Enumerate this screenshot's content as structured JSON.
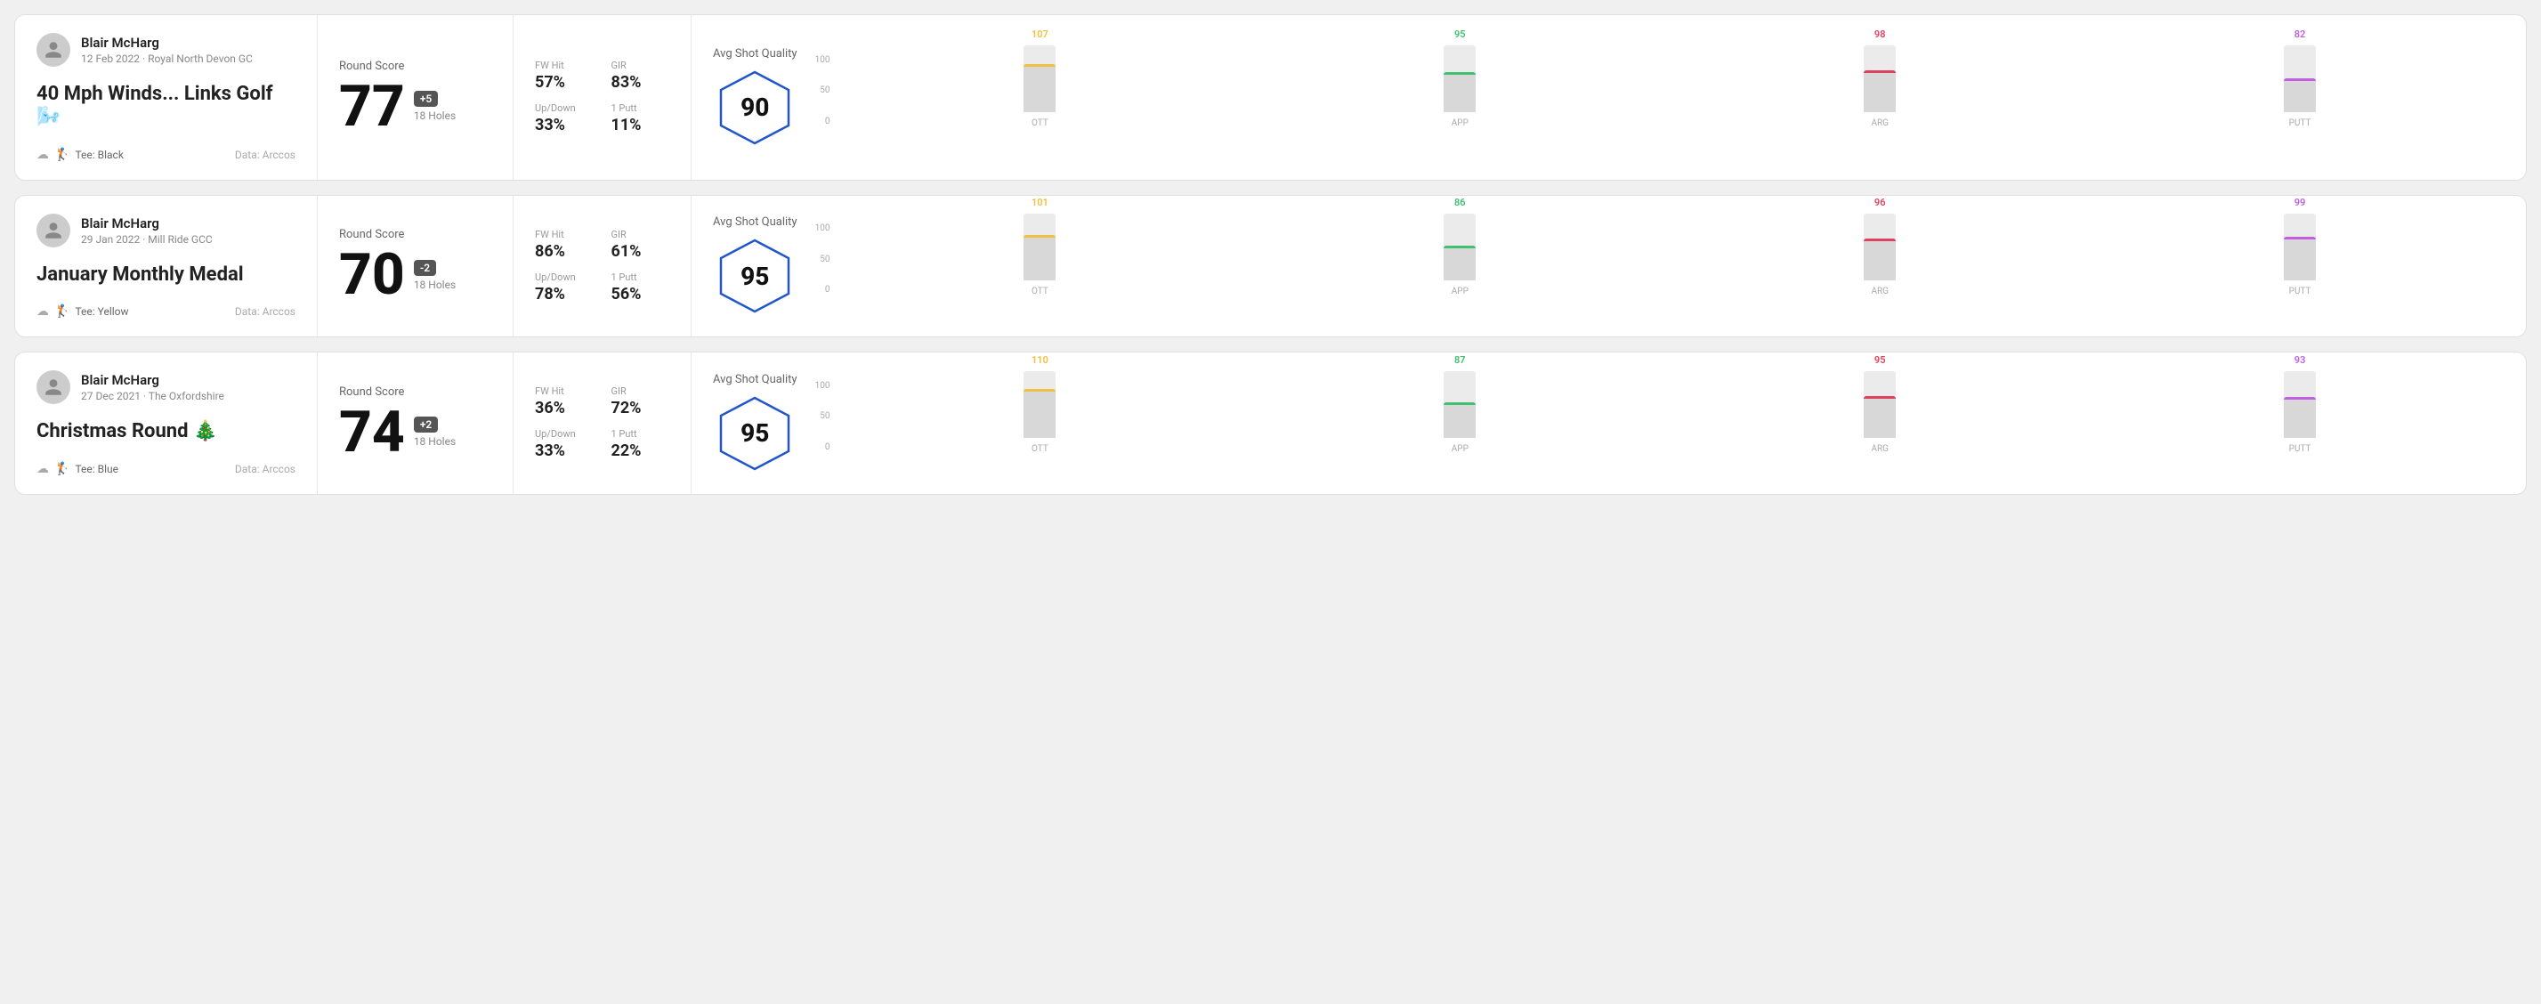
{
  "rounds": [
    {
      "id": "round-1",
      "user": {
        "name": "Blair McHarg",
        "meta": "12 Feb 2022 · Royal North Devon GC"
      },
      "title": "40 Mph Winds... Links Golf 🌬️",
      "tee": "Black",
      "data_source": "Data: Arccos",
      "score": {
        "label": "Round Score",
        "number": "77",
        "diff": "+5",
        "holes": "18 Holes"
      },
      "stats": {
        "fw_hit_label": "FW Hit",
        "fw_hit": "57%",
        "gir_label": "GIR",
        "gir": "83%",
        "updown_label": "Up/Down",
        "updown": "33%",
        "oneputt_label": "1 Putt",
        "oneputt": "11%"
      },
      "quality": {
        "label": "Avg Shot Quality",
        "score": "90",
        "bars": [
          {
            "label": "OTT",
            "value": 107,
            "color": "#f0c040",
            "bar_pct": 72
          },
          {
            "label": "APP",
            "value": 95,
            "color": "#40c070",
            "bar_pct": 60
          },
          {
            "label": "ARG",
            "value": 98,
            "color": "#e04060",
            "bar_pct": 63
          },
          {
            "label": "PUTT",
            "value": 82,
            "color": "#c060e0",
            "bar_pct": 50
          }
        ]
      }
    },
    {
      "id": "round-2",
      "user": {
        "name": "Blair McHarg",
        "meta": "29 Jan 2022 · Mill Ride GCC"
      },
      "title": "January Monthly Medal",
      "tee": "Yellow",
      "data_source": "Data: Arccos",
      "score": {
        "label": "Round Score",
        "number": "70",
        "diff": "-2",
        "holes": "18 Holes"
      },
      "stats": {
        "fw_hit_label": "FW Hit",
        "fw_hit": "86%",
        "gir_label": "GIR",
        "gir": "61%",
        "updown_label": "Up/Down",
        "updown": "78%",
        "oneputt_label": "1 Putt",
        "oneputt": "56%"
      },
      "quality": {
        "label": "Avg Shot Quality",
        "score": "95",
        "bars": [
          {
            "label": "OTT",
            "value": 101,
            "color": "#f0c040",
            "bar_pct": 68
          },
          {
            "label": "APP",
            "value": 86,
            "color": "#40c070",
            "bar_pct": 52
          },
          {
            "label": "ARG",
            "value": 96,
            "color": "#e04060",
            "bar_pct": 63
          },
          {
            "label": "PUTT",
            "value": 99,
            "color": "#c060e0",
            "bar_pct": 65
          }
        ]
      }
    },
    {
      "id": "round-3",
      "user": {
        "name": "Blair McHarg",
        "meta": "27 Dec 2021 · The Oxfordshire"
      },
      "title": "Christmas Round 🎄",
      "tee": "Blue",
      "data_source": "Data: Arccos",
      "score": {
        "label": "Round Score",
        "number": "74",
        "diff": "+2",
        "holes": "18 Holes"
      },
      "stats": {
        "fw_hit_label": "FW Hit",
        "fw_hit": "36%",
        "gir_label": "GIR",
        "gir": "72%",
        "updown_label": "Up/Down",
        "updown": "33%",
        "oneputt_label": "1 Putt",
        "oneputt": "22%"
      },
      "quality": {
        "label": "Avg Shot Quality",
        "score": "95",
        "bars": [
          {
            "label": "OTT",
            "value": 110,
            "color": "#f0c040",
            "bar_pct": 73
          },
          {
            "label": "APP",
            "value": 87,
            "color": "#40c070",
            "bar_pct": 53
          },
          {
            "label": "ARG",
            "value": 95,
            "color": "#e04060",
            "bar_pct": 62
          },
          {
            "label": "PUTT",
            "value": 93,
            "color": "#c060e0",
            "bar_pct": 61
          }
        ]
      }
    }
  ],
  "y_axis_labels": [
    "100",
    "50",
    "0"
  ]
}
